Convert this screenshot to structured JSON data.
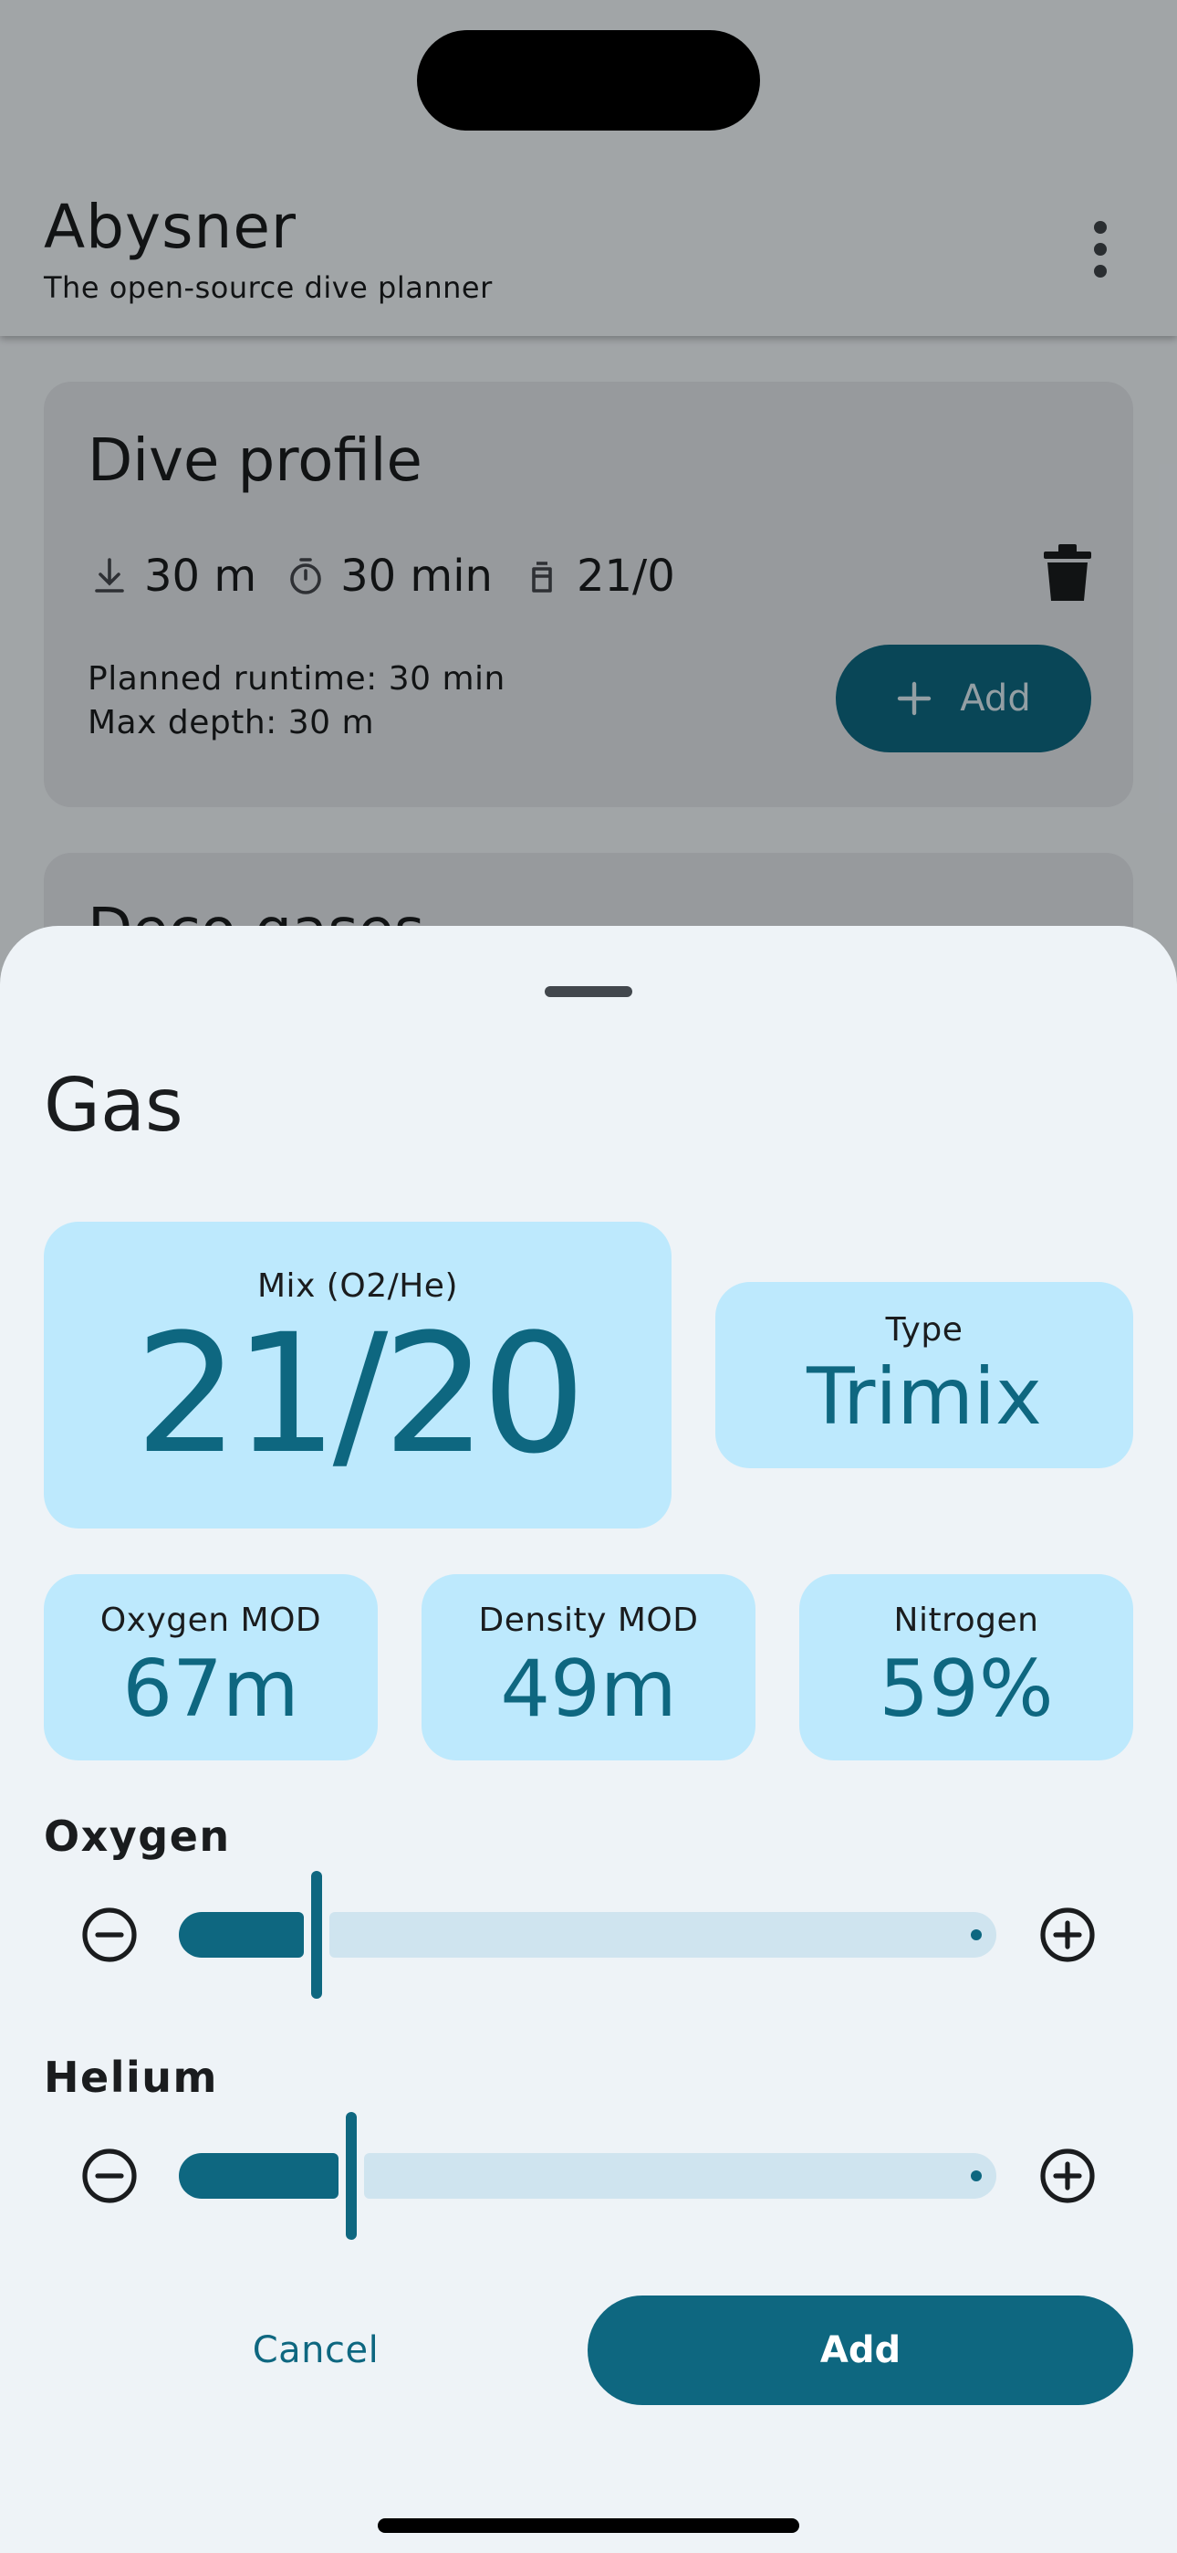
{
  "app": {
    "title": "Abysner",
    "subtitle": "The open-source dive planner",
    "menu_icon": "more-vert-icon"
  },
  "dive_profile": {
    "title": "Dive profile",
    "segment": {
      "depth": "30 m",
      "duration": "30 min",
      "gas": "21/0"
    },
    "runtime": "Planned runtime: 30 min",
    "max_depth": "Max depth: 30 m",
    "add_label": "Add",
    "icons": [
      "depth-down-icon",
      "timer-icon",
      "tank-icon",
      "trash-icon",
      "plus-icon"
    ]
  },
  "deco_card": {
    "title": "Deco gases"
  },
  "sheet": {
    "title": "Gas",
    "mix": {
      "label": "Mix (O2/He)",
      "value": "21/20"
    },
    "type": {
      "label": "Type",
      "value": "Trimix"
    },
    "oxygen_mod": {
      "label": "Oxygen MOD",
      "value": "67m"
    },
    "density_mod": {
      "label": "Density MOD",
      "value": "49m"
    },
    "nitrogen": {
      "label": "Nitrogen",
      "value": "59%"
    },
    "oxygen_slider": {
      "label": "Oxygen",
      "value": 21,
      "min": 5,
      "max": 100
    },
    "helium_slider": {
      "label": "Helium",
      "value": 20,
      "min": 0,
      "max": 95
    },
    "cancel_label": "Cancel",
    "add_label": "Add"
  },
  "colors": {
    "primary": "#0e6780",
    "tile": "#bde9fd",
    "track_inactive": "#cfe4ef",
    "background": "#eef3f7"
  }
}
